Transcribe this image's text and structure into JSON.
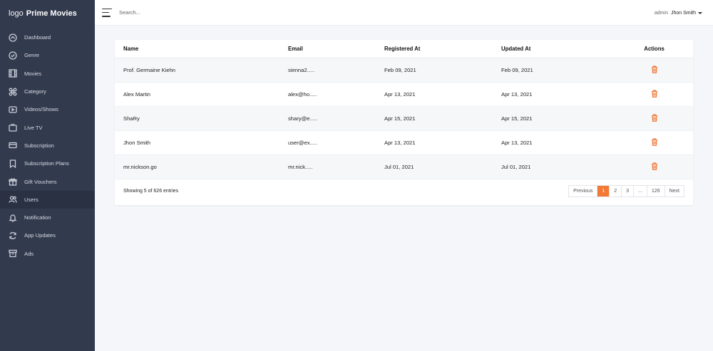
{
  "brand": {
    "logo_word": "logo",
    "name": "Prime Movies"
  },
  "sidebar": {
    "items": [
      {
        "label": "Dashboard",
        "icon": "dashboard-icon"
      },
      {
        "label": "Genre",
        "icon": "genre-icon"
      },
      {
        "label": "Movies",
        "icon": "film-icon"
      },
      {
        "label": "Category",
        "icon": "category-icon"
      },
      {
        "label": "Videos/Shows",
        "icon": "video-icon"
      },
      {
        "label": "Live TV",
        "icon": "tv-icon"
      },
      {
        "label": "Subscription",
        "icon": "card-icon"
      },
      {
        "label": "Subscription Plans",
        "icon": "bookmark-icon"
      },
      {
        "label": "Gift Vouchers",
        "icon": "gift-icon"
      },
      {
        "label": "Users",
        "icon": "users-icon",
        "active": true
      },
      {
        "label": "Notification",
        "icon": "bell-icon"
      },
      {
        "label": "App Updates",
        "icon": "refresh-icon"
      },
      {
        "label": "Ads",
        "icon": "archive-icon"
      }
    ]
  },
  "topbar": {
    "search_placeholder": "Search...",
    "role": "admin",
    "username": "Jhon Smith"
  },
  "table": {
    "headers": {
      "name": "Name",
      "email": "Email",
      "registered": "Registered At",
      "updated": "Updated At",
      "actions": "Actions"
    },
    "rows": [
      {
        "name": "Prof. Germaine Kiehn",
        "email": "sienna2.....",
        "registered": "Feb 09, 2021",
        "updated": "Feb 09, 2021"
      },
      {
        "name": "Alex Martin",
        "email": "alex@ho.....",
        "registered": "Apr 13, 2021",
        "updated": "Apr 13, 2021"
      },
      {
        "name": "ShaRy",
        "email": "shary@e.....",
        "registered": "Apr 15, 2021",
        "updated": "Apr 15, 2021"
      },
      {
        "name": "Jhon Smith",
        "email": "user@ex.....",
        "registered": "Apr 13, 2021",
        "updated": "Apr 13, 2021"
      },
      {
        "name": "mr.nickson.go",
        "email": "mr.nick.....",
        "registered": "Jul 01, 2021",
        "updated": "Jul 01, 2021"
      }
    ]
  },
  "footer": {
    "entries_text": "Showing 5 of 626 entries",
    "pagination": {
      "previous": "Previous",
      "pages": [
        "1",
        "2",
        "3",
        "...",
        "126"
      ],
      "active_page": "1",
      "next": "Next"
    }
  },
  "colors": {
    "sidebar_bg": "#323a4d",
    "accent": "#f37a36",
    "page_bg": "#f4f6f9"
  }
}
